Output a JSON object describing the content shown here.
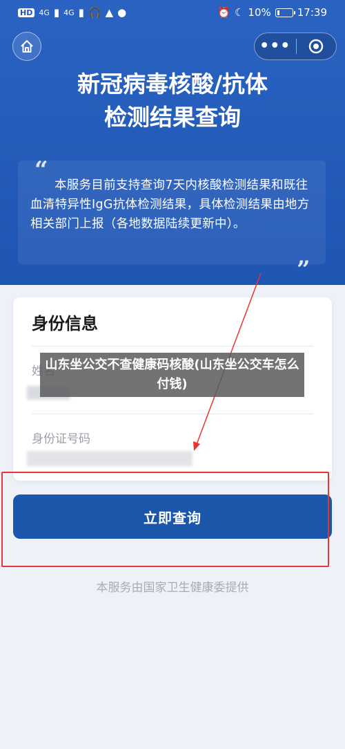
{
  "status_bar": {
    "left_chip": "HD",
    "signal_1": "4G",
    "signal_2": "4G",
    "battery": "10%",
    "time": "17:39"
  },
  "nav": {
    "home_icon": "home-icon",
    "more_icon": "more-dots-icon",
    "close_icon": "target-icon"
  },
  "page": {
    "title_line1": "新冠病毒核酸/抗体",
    "title_line2": "检测结果查询",
    "notice": "本服务目前支持查询7天内核酸检测结果和既往血清特异性IgG抗体检测结果，具体检测结果由地方相关部门上报（各地数据陆续更新中）。",
    "quote_open": "“",
    "quote_close": "”"
  },
  "form": {
    "section_title": "身份信息",
    "name_label": "姓名",
    "id_label": "身份证号码"
  },
  "actions": {
    "query_label": "立即查询"
  },
  "footer": {
    "text": "本服务由国家卫生健康委提供"
  },
  "overlay": {
    "text": "山东坐公交不查健康码核酸(山东坐公交车怎么付钱)"
  },
  "colors": {
    "hero": "#1f55b3",
    "button": "#1c56aa",
    "annotation": "#e8352f"
  }
}
